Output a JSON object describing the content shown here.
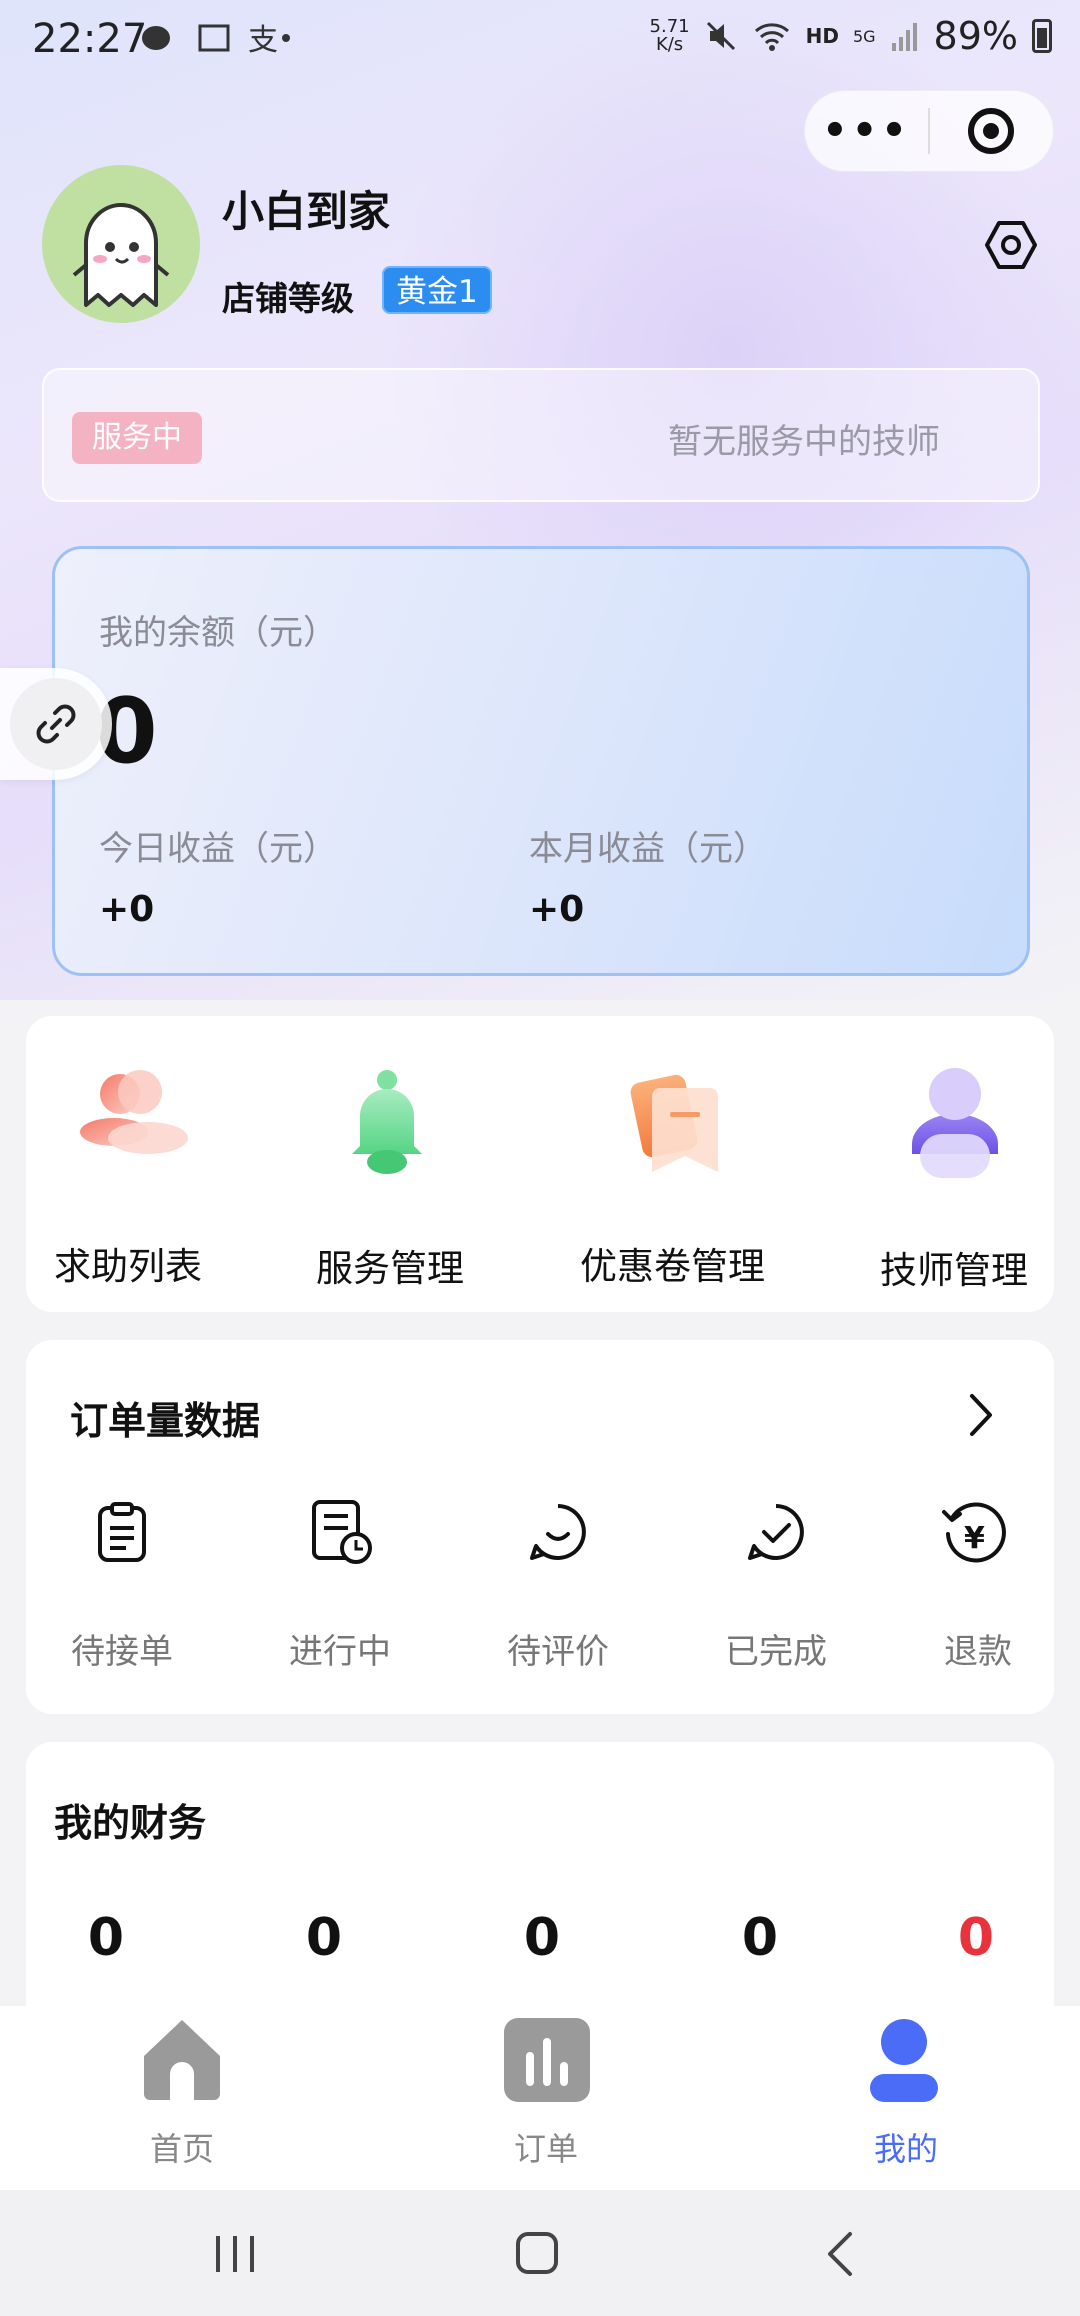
{
  "status_bar": {
    "time": "22:27",
    "speed_value": "5.71",
    "speed_unit": "K/s",
    "hd": "HD",
    "net": "5G",
    "battery": "89%"
  },
  "profile": {
    "shop_name": "小白到家",
    "level_label": "店铺等级",
    "level_badge": "黄金1"
  },
  "service": {
    "tag": "服务中",
    "empty_text": "暂无服务中的技师"
  },
  "balance": {
    "balance_label": "我的余额（元）",
    "balance_value": "0",
    "today_label": "今日收益（元）",
    "today_value": "+0",
    "month_label": "本月收益（元）",
    "month_value": "+0"
  },
  "quick_menu": [
    {
      "label": "求助列表",
      "icon": "people-icon"
    },
    {
      "label": "服务管理",
      "icon": "bell-icon"
    },
    {
      "label": "优惠卷管理",
      "icon": "coupon-icon"
    },
    {
      "label": "技师管理",
      "icon": "technician-icon"
    }
  ],
  "orders": {
    "title": "订单量数据",
    "items": [
      {
        "label": "待接单",
        "icon": "clipboard-icon"
      },
      {
        "label": "进行中",
        "icon": "doc-clock-icon"
      },
      {
        "label": "待评价",
        "icon": "smile-chat-icon"
      },
      {
        "label": "已完成",
        "icon": "check-chat-icon"
      },
      {
        "label": "退款",
        "icon": "refund-icon"
      }
    ]
  },
  "finance": {
    "title": "我的财务",
    "values": [
      "0",
      "0",
      "0",
      "0",
      "0"
    ],
    "accent_color": "#e8323c"
  },
  "tabbar": [
    {
      "label": "首页",
      "icon": "home-icon"
    },
    {
      "label": "订单",
      "icon": "chart-icon"
    },
    {
      "label": "我的",
      "icon": "user-icon"
    }
  ],
  "colors": {
    "active_tab": "#4a6cf7",
    "badge_blue": "#2d8cf0",
    "tag_pink": "#f4b3c3"
  }
}
